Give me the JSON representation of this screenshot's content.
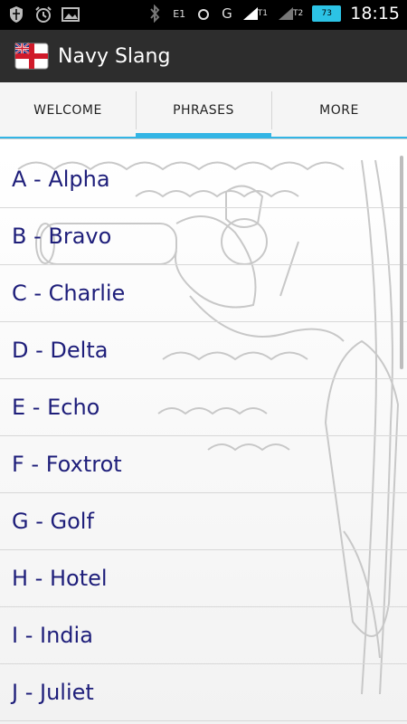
{
  "status_bar": {
    "network_e": "E1",
    "network_g": "G",
    "signal_1": "T1",
    "signal_2": "T2",
    "battery_level": "73",
    "time": "18:15"
  },
  "app": {
    "title": "Navy Slang"
  },
  "tabs": [
    {
      "label": "WELCOME",
      "active": false
    },
    {
      "label": "PHRASES",
      "active": true
    },
    {
      "label": "MORE",
      "active": false
    }
  ],
  "list": {
    "items": [
      "A - Alpha",
      "B - Bravo",
      "C - Charlie",
      "D - Delta",
      "E - Echo",
      "F - Foxtrot",
      "G - Golf",
      "H - Hotel",
      "I - India",
      "J - Juliet"
    ]
  },
  "colors": {
    "accent": "#33b5e5",
    "list_text": "#1e1e7a",
    "appbar_bg": "#2d2d2d"
  }
}
